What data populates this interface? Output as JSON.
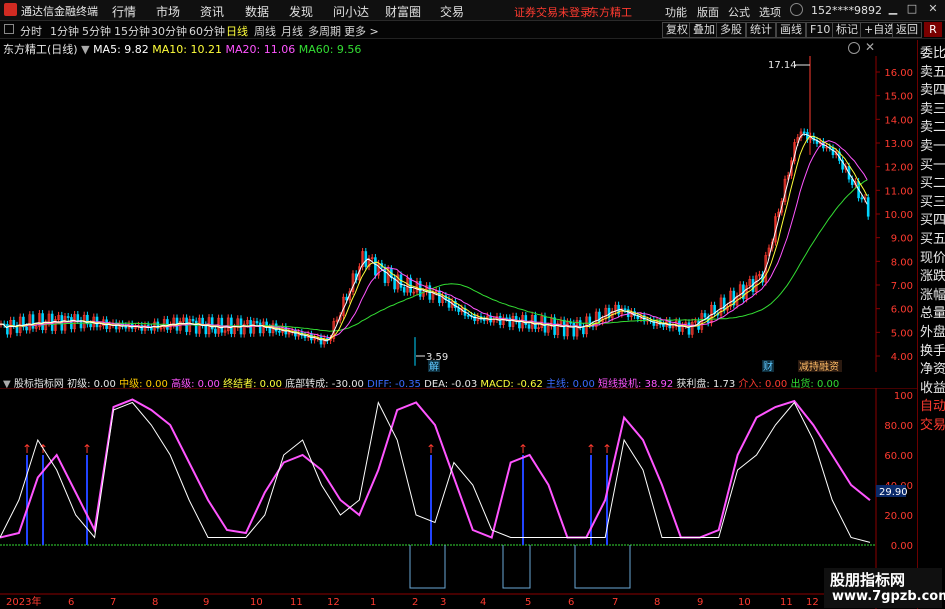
{
  "app": {
    "title": "通达信金融终端",
    "menu": [
      "行情",
      "市场",
      "资讯",
      "数据",
      "发现",
      "问小达",
      "财富圈",
      "交易"
    ],
    "warning": "证券交易未登录",
    "stock_link": "东方精工",
    "right_menu": [
      "功能",
      "版面",
      "公式",
      "选项"
    ],
    "account": "152****9892",
    "window_controls": [
      "▁",
      "□",
      "✕"
    ]
  },
  "periods": {
    "tabs": [
      "分时",
      "1分钟",
      "5分钟",
      "15分钟",
      "30分钟",
      "60分钟",
      "日线",
      "周线",
      "月线",
      "多周期",
      "更多 >"
    ],
    "active": "日线"
  },
  "toolbar_right": [
    "复权",
    "叠加",
    "多股",
    "统计",
    "画线",
    "F10",
    "标记",
    "+自选",
    "返回"
  ],
  "main_legend": {
    "name": "东方精工(日线)",
    "ma": [
      {
        "label": "MA5: 9.82",
        "color": "#ffffff"
      },
      {
        "label": "MA10: 10.21",
        "color": "#ffff3a"
      },
      {
        "label": "MA20: 11.06",
        "color": "#ff55ff"
      },
      {
        "label": "MA60: 9.56",
        "color": "#33dd33"
      }
    ]
  },
  "price_axis": [
    "16.00",
    "15.00",
    "14.00",
    "13.00",
    "12.00",
    "11.00",
    "10.00",
    "9.00",
    "8.00",
    "7.00",
    "6.00",
    "5.00",
    "4.00"
  ],
  "annotations": {
    "high": "17.14",
    "low": "3.59",
    "unlock": "解",
    "finance": "财",
    "tags": "减持融资"
  },
  "sub_legend": [
    {
      "label": "股标指标网",
      "color": "#e6e6e6"
    },
    {
      "label": "初级: 0.00",
      "color": "#e6e6e6"
    },
    {
      "label": "中级: 0.00",
      "color": "#ffcc00"
    },
    {
      "label": "高级: 0.00",
      "color": "#ff55ff"
    },
    {
      "label": "终结者: 0.00",
      "color": "#ffff3a"
    },
    {
      "label": "底部转成: -30.00",
      "color": "#e6e6e6"
    },
    {
      "label": "DIFF: -0.35",
      "color": "#3a6bff"
    },
    {
      "label": "DEA: -0.03",
      "color": "#e6e6e6"
    },
    {
      "label": "MACD: -0.62",
      "color": "#ffff3a"
    },
    {
      "label": "主线: 0.00",
      "color": "#3a6bff"
    },
    {
      "label": "短线投机: 38.92",
      "color": "#ff55ff"
    },
    {
      "label": "获利盘: 1.73",
      "color": "#e6e6e6"
    },
    {
      "label": "介入: 0.00",
      "color": "#ff3b30"
    },
    {
      "label": "出货: 0.00",
      "color": "#33dd33"
    }
  ],
  "sub_axis": [
    "100",
    "80.00",
    "60.00",
    "40.00",
    "20.00",
    "0.00"
  ],
  "sub_current": "29.90",
  "x_axis": [
    "2023年",
    "6",
    "7",
    "8",
    "9",
    "10",
    "11",
    "12",
    "1",
    "2",
    "3",
    "4",
    "5",
    "6",
    "7",
    "8",
    "9",
    "10",
    "11",
    "12",
    "1"
  ],
  "sidebar": [
    "委比",
    "卖五",
    "卖四",
    "卖三",
    "卖二",
    "卖一",
    "买一",
    "买二",
    "买三",
    "买四",
    "买五",
    "现价",
    "涨跌",
    "涨幅",
    "总量",
    "外盘",
    "换手",
    "净资",
    "收益",
    "自动",
    "交易"
  ],
  "watermark": {
    "line1": "股朋指标网",
    "line2": "www.7gpzb.com"
  },
  "chart_data": {
    "type": "candlestick",
    "title": "东方精工(日线)",
    "ylim": [
      3.5,
      17.5
    ],
    "x_months": [
      "2023-05",
      "2023-06",
      "2023-07",
      "2023-08",
      "2023-09",
      "2023-10",
      "2023-11",
      "2023-12",
      "2024-01",
      "2024-02",
      "2024-03",
      "2024-04",
      "2024-05",
      "2024-06",
      "2024-07",
      "2024-08",
      "2024-09",
      "2024-10",
      "2024-11",
      "2024-12",
      "2025-01"
    ],
    "close_series": [
      5.2,
      5.4,
      5.5,
      5.3,
      5.2,
      5.4,
      5.2,
      5.3,
      5.0,
      4.6,
      8.2,
      7.0,
      6.6,
      5.6,
      5.5,
      5.3,
      5.2,
      6.0,
      5.4,
      5.2,
      6.2,
      7.4,
      13.5,
      12.6,
      10.0
    ],
    "high": 17.14,
    "low": 3.59,
    "ma_lines": {
      "MA5": 9.82,
      "MA10": 10.21,
      "MA20": 11.06,
      "MA60": 9.56
    }
  },
  "sub_chart_data": {
    "type": "line",
    "ylim": [
      0,
      100
    ],
    "series": [
      {
        "name": "短线投机",
        "color": "#ff55ff",
        "values": [
          5,
          8,
          45,
          60,
          35,
          10,
          92,
          97,
          90,
          80,
          55,
          30,
          10,
          8,
          35,
          55,
          60,
          50,
          30,
          20,
          50,
          90,
          95,
          80,
          45,
          10,
          5,
          55,
          60,
          40,
          5,
          5,
          30,
          85,
          70,
          40,
          5,
          5,
          10,
          60,
          85,
          92,
          96,
          80,
          60,
          40,
          29.9
        ]
      },
      {
        "name": "获利盘",
        "color": "#ffffff",
        "values": [
          5,
          30,
          70,
          50,
          20,
          5,
          90,
          95,
          80,
          60,
          30,
          5,
          5,
          5,
          20,
          60,
          70,
          40,
          20,
          30,
          95,
          70,
          20,
          15,
          55,
          40,
          10,
          5,
          5,
          5,
          5,
          5,
          5,
          70,
          50,
          5,
          5,
          5,
          5,
          50,
          60,
          80,
          95,
          70,
          30,
          5,
          1.73
        ]
      }
    ]
  }
}
